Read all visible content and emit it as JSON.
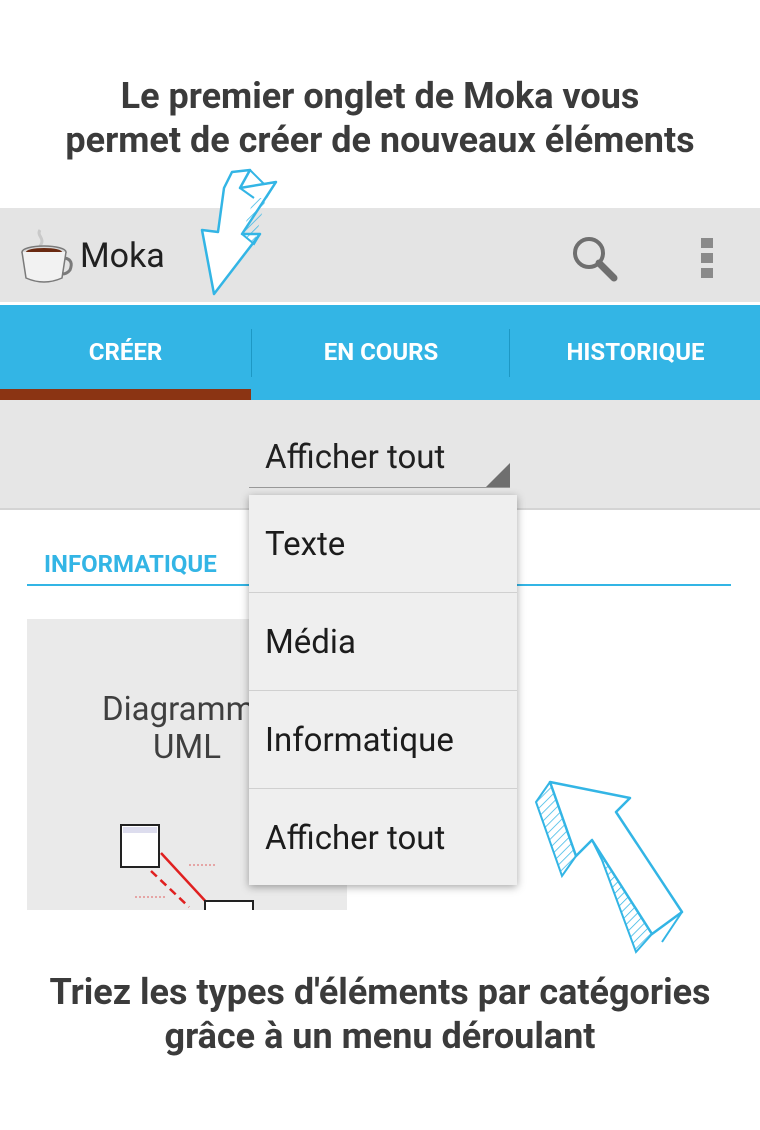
{
  "captions": {
    "top_line1": "Le premier onglet de Moka vous",
    "top_line2": "permet de créer de nouveaux éléments",
    "bottom_line1": "Triez les types d'éléments par catégories",
    "bottom_line2": "grâce à un menu déroulant"
  },
  "actionbar": {
    "title": "Moka",
    "icons": [
      "coffee-cup-icon",
      "search-icon",
      "overflow-menu-icon"
    ]
  },
  "tabs": [
    {
      "label": "CRÉER",
      "selected": true
    },
    {
      "label": "EN COURS",
      "selected": false
    },
    {
      "label": "HISTORIQUE",
      "selected": false
    }
  ],
  "filter": {
    "selected": "Afficher tout"
  },
  "section": {
    "label": "INFORMATIQUE"
  },
  "card": {
    "title_line1": "Diagramme",
    "title_line2": "UML"
  },
  "dropdown": {
    "options": [
      "Texte",
      "Média",
      "Informatique",
      "Afficher tout"
    ]
  },
  "colors": {
    "accent": "#33b5e5",
    "tab_indicator": "#8b3413",
    "actionbar": "#e4e4e4",
    "caption_text": "#3b3b3b"
  }
}
